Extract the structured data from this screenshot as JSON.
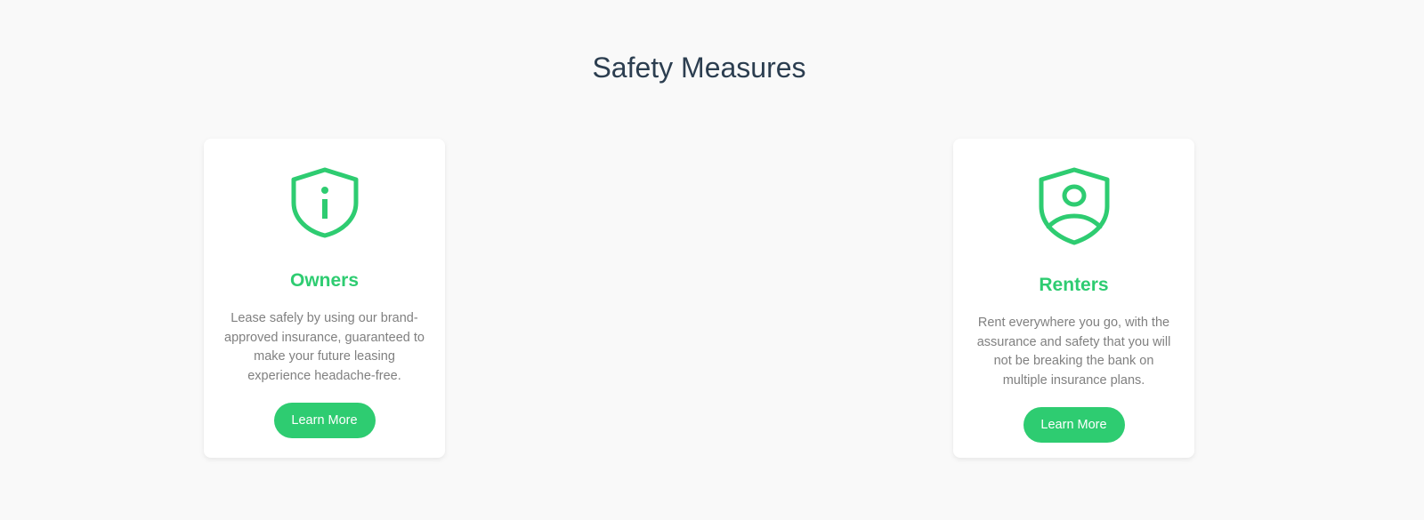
{
  "section": {
    "title": "Safety Measures"
  },
  "colors": {
    "accent": "#2ecc71",
    "title": "#2c3e50",
    "body_text": "#808080",
    "background": "#f9f9f9",
    "card": "#ffffff"
  },
  "cards": [
    {
      "icon": "shield-info-icon",
      "title": "Owners",
      "text": "Lease safely by using our brand-approved insurance, guaranteed to make your future leasing experience headache-free.",
      "button_label": "Learn More"
    },
    {
      "icon": "shield-user-icon",
      "title": "Renters",
      "text": "Rent everywhere you go, with the assurance and safety that you will not be breaking the bank on multiple insurance plans.",
      "button_label": "Learn More"
    }
  ]
}
